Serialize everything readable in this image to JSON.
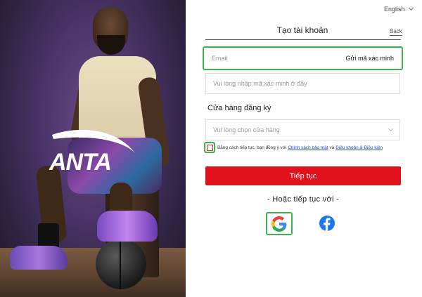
{
  "header": {
    "language": "English"
  },
  "form": {
    "title": "Tạo tài khoản",
    "back_label": "Back",
    "email_placeholder": "Email",
    "send_code_label": "Gửi mã xác minh",
    "code_placeholder": "Vui lòng nhập mã xác minh ở đây",
    "store_label": "Cửa hàng đăng ký",
    "store_placeholder": "Vui lòng chọn cửa hàng",
    "agree_prefix": "Bằng cách tiếp tục, bạn đồng ý với",
    "privacy_link": "Chính sách bảo mật",
    "agree_and": "và",
    "terms_link": "Điều khoản & Điều kiện",
    "submit_label": "Tiếp tục",
    "or_label": "- Hoặc tiếp tục với -"
  },
  "brand": {
    "logo_text": "ANTA"
  },
  "social": {
    "google_icon": "google-icon",
    "facebook_icon": "facebook-icon"
  },
  "colors": {
    "accent_red": "#e0111b",
    "highlight_green": "#3cb54a",
    "link_blue": "#1a4fd0",
    "facebook_blue": "#1877f2"
  }
}
